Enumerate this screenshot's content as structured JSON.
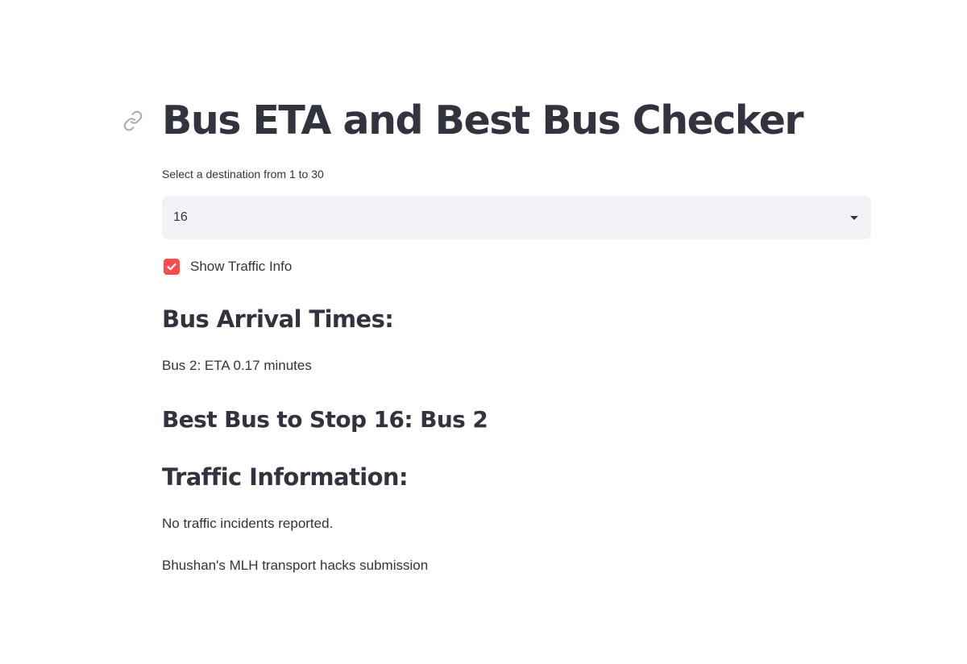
{
  "header": {
    "title": "Bus ETA and Best Bus Checker"
  },
  "destination_select": {
    "label": "Select a destination from 1 to 30",
    "value": "16"
  },
  "traffic_checkbox": {
    "label": "Show Traffic Info",
    "checked": true
  },
  "arrival": {
    "heading": "Bus Arrival Times:",
    "items": [
      "Bus 2: ETA 0.17 minutes"
    ]
  },
  "best_bus": {
    "heading": "Best Bus to Stop 16: Bus 2"
  },
  "traffic": {
    "heading": "Traffic Information:",
    "message": "No traffic incidents reported."
  },
  "footer": {
    "text": "Bhushan's MLH transport hacks submission"
  },
  "colors": {
    "text": "#31333f",
    "accent": "#ff4b4b",
    "input_bg": "#f0f2f6"
  },
  "icons": {
    "title_anchor": "link-icon",
    "select_caret": "chevron-down-icon",
    "checkbox_mark": "checkmark-icon"
  }
}
